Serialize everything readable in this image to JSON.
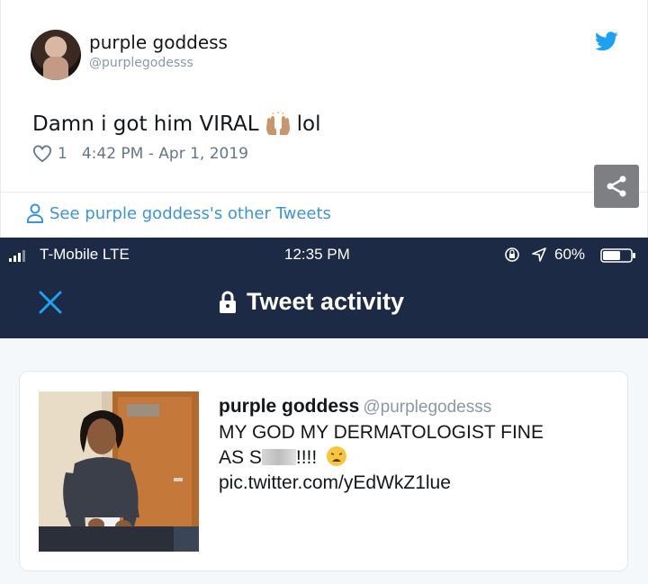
{
  "tweet": {
    "display_name": "purple goddess",
    "handle": "@purplegodesss",
    "text_before_emoji": "Damn i got him VIRAL",
    "emoji": "raised-hands-emoji",
    "text_after_emoji": "lol",
    "like_count": "1",
    "timestamp": "4:42 PM - Apr 1, 2019",
    "other_tweets_link": "See purple goddess's other Tweets"
  },
  "phone": {
    "status_bar": {
      "carrier": "T-Mobile  LTE",
      "time": "12:35 PM",
      "battery": "60%"
    },
    "nav": {
      "title": "Tweet activity"
    },
    "embedded_tweet": {
      "display_name": "purple goddess",
      "handle": "@purplegodesss",
      "line1": "MY GOD MY DERMATOLOGIST FINE",
      "line2_prefix": "AS S",
      "line2_suffix": "!!!!",
      "link": "pic.twitter.com/yEdWkZ1lue"
    }
  },
  "colors": {
    "twitter_blue": "#1da1f2",
    "link_blue": "#3b94d9",
    "navy": "#1c2a45",
    "muted": "#657786"
  },
  "icons": [
    "twitter-bird-icon",
    "heart-icon",
    "person-icon",
    "share-icon",
    "close-icon",
    "padlock-icon",
    "signal-icon",
    "location-icon",
    "battery-icon"
  ]
}
